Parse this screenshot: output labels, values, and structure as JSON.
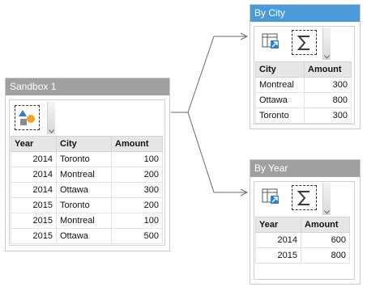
{
  "colors": {
    "sandbox_header": "#a0a0a0",
    "by_city_header": "#4a9ad9",
    "by_year_header": "#a0a0a0",
    "connector": "#6a6a6a"
  },
  "sandbox": {
    "title": "Sandbox 1",
    "tool_icon": "shapes-icon",
    "columns": [
      "Year",
      "City",
      "Amount"
    ],
    "rows": [
      [
        "2014",
        "Toronto",
        "100"
      ],
      [
        "2014",
        "Montreal",
        "200"
      ],
      [
        "2014",
        "Ottawa",
        "300"
      ],
      [
        "2015",
        "Toronto",
        "200"
      ],
      [
        "2015",
        "Montreal",
        "100"
      ],
      [
        "2015",
        "Ottawa",
        "500"
      ]
    ]
  },
  "by_city": {
    "title": "By City",
    "tool_icons": [
      "table-icon",
      "sum-icon"
    ],
    "columns": [
      "City",
      "Amount"
    ],
    "rows": [
      [
        "Montreal",
        "300"
      ],
      [
        "Ottawa",
        "800"
      ],
      [
        "Toronto",
        "300"
      ]
    ]
  },
  "by_year": {
    "title": "By Year",
    "tool_icons": [
      "table-icon",
      "sum-icon"
    ],
    "columns": [
      "Year",
      "Amount"
    ],
    "rows": [
      [
        "2014",
        "600"
      ],
      [
        "2015",
        "800"
      ]
    ]
  }
}
